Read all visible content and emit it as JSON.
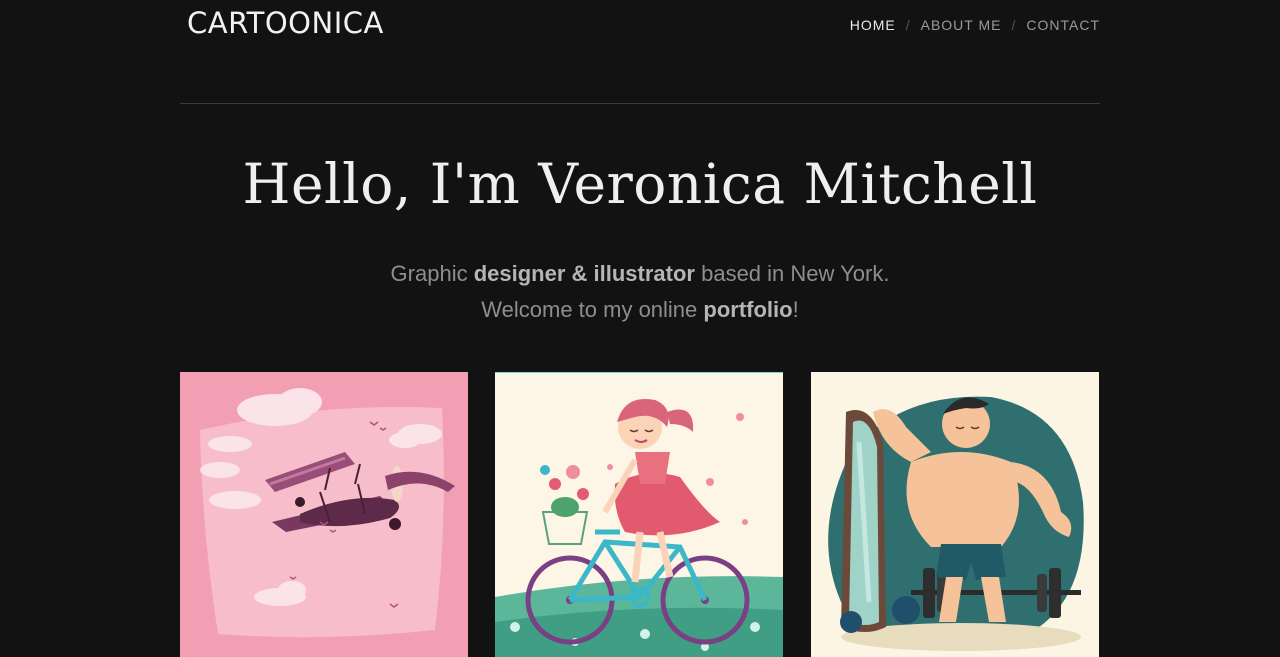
{
  "brand": {
    "logo": "CARTOONICA"
  },
  "nav": {
    "items": [
      {
        "label": "HOME",
        "active": true
      },
      {
        "label": "ABOUT ME",
        "active": false
      },
      {
        "label": "CONTACT",
        "active": false
      }
    ],
    "separator": "/"
  },
  "hero": {
    "title": "Hello, I'm Veronica Mitchell",
    "line1": {
      "pre": "Graphic ",
      "bold": "designer & illustrator",
      "post": " based in New York."
    },
    "line2": {
      "pre": "Welcome to my online ",
      "bold": "portfolio",
      "post": "!"
    }
  },
  "portfolio": [
    {
      "subject": "airplane illustration"
    },
    {
      "subject": "girl riding bicycle illustration"
    },
    {
      "subject": "bodybuilder mirror illustration"
    }
  ],
  "colors": {
    "background": "#121212",
    "text_light": "#efefef",
    "text_muted": "#8e8e8e"
  }
}
